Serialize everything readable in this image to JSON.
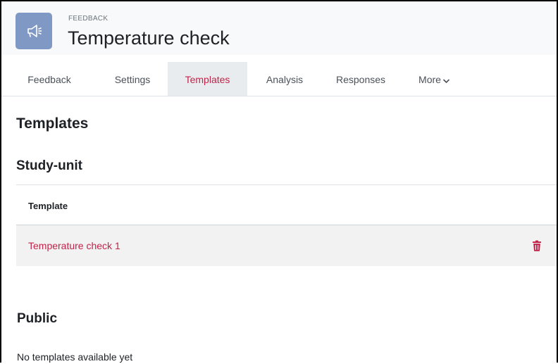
{
  "header": {
    "activity_type": "FEEDBACK",
    "title": "Temperature check",
    "icon": "megaphone-icon",
    "icon_bg": "#7f98c4"
  },
  "tabs": [
    {
      "label": "Feedback",
      "active": false
    },
    {
      "label": "Settings",
      "active": false
    },
    {
      "label": "Templates",
      "active": true
    },
    {
      "label": "Analysis",
      "active": false
    },
    {
      "label": "Responses",
      "active": false
    },
    {
      "label": "More",
      "active": false,
      "icon": "chevron-down-icon"
    }
  ],
  "page_heading": "Templates",
  "study_unit": {
    "heading": "Study-unit",
    "column_header": "Template",
    "rows": [
      {
        "name": "Temperature check 1",
        "action_icon": "trash-icon"
      }
    ]
  },
  "public": {
    "heading": "Public",
    "empty_message": "No templates available yet"
  },
  "colors": {
    "link": "#c0244a",
    "active_tab_bg": "#e9ecef",
    "row_bg": "#f2f2f2"
  }
}
